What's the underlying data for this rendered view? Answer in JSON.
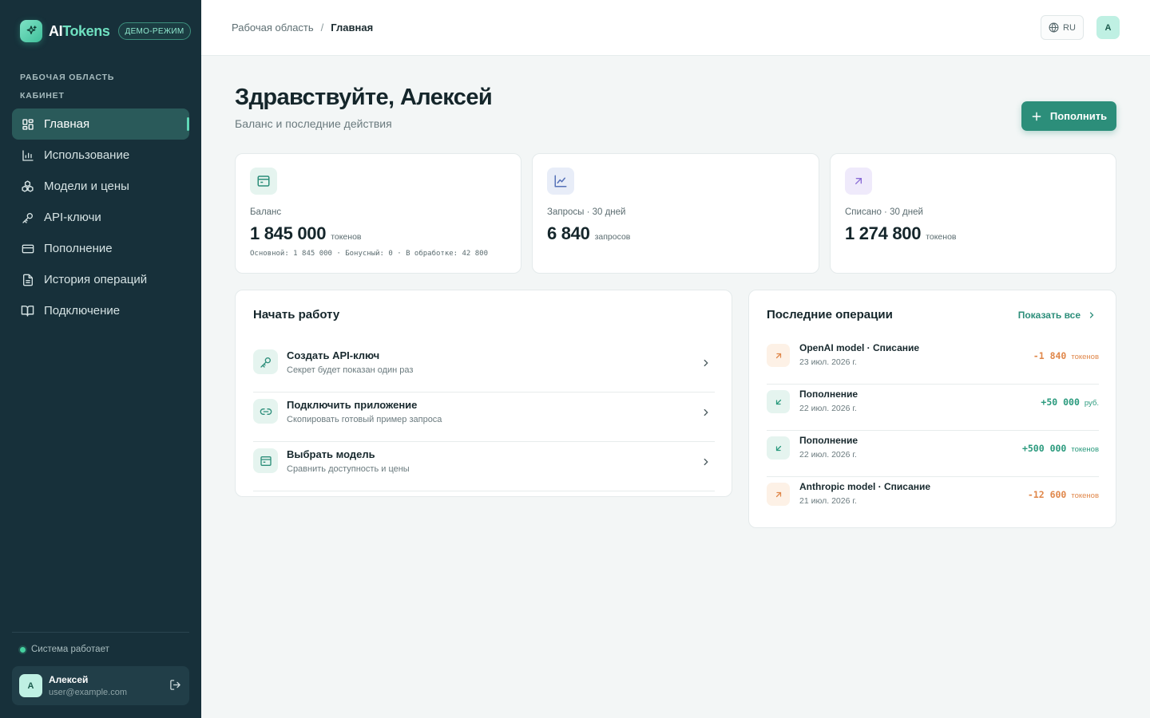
{
  "app": {
    "name_part1": "AI",
    "name_part2": "Tokens",
    "demo_badge": "ДЕМО-РЕЖИМ"
  },
  "sidebar": {
    "section_labels": [
      "РАБОЧАЯ ОБЛАСТЬ",
      "КАБИНЕТ"
    ],
    "items": [
      {
        "label": "Главная",
        "icon": "dashboard-icon",
        "active": true
      },
      {
        "label": "Использование",
        "icon": "bar-chart-icon"
      },
      {
        "label": "Модели и цены",
        "icon": "models-icon"
      },
      {
        "label": "API-ключи",
        "icon": "key-icon"
      },
      {
        "label": "Пополнение",
        "icon": "credit-card-icon"
      },
      {
        "label": "История операций",
        "icon": "document-icon"
      },
      {
        "label": "Подключение",
        "icon": "book-icon"
      }
    ],
    "system_status": "Система работает",
    "user": {
      "initial": "А",
      "name": "Алексей",
      "email": "user@example.com"
    }
  },
  "topbar": {
    "breadcrumb": {
      "root": "Рабочая область",
      "separator": "/",
      "current": "Главная"
    },
    "language": "RU",
    "avatar_initial": "А"
  },
  "main": {
    "greeting": "Здравствуйте, Алексей",
    "subtitle": "Баланс и последние действия",
    "topup_label": "Пополнить",
    "stats": [
      {
        "label": "Баланс",
        "value": "1 845 000",
        "unit": "токенов",
        "detail": "Основной: 1 845 000 · Бонусный: 0 · В обработке: 42 800",
        "icon": "wallet-icon"
      },
      {
        "label": "Запросы · 30 дней",
        "value": "6 840",
        "unit": "запросов",
        "icon": "line-chart-icon"
      },
      {
        "label": "Списано · 30 дней",
        "value": "1 274 800",
        "unit": "токенов",
        "icon": "arrow-up-right-icon"
      }
    ],
    "quick_start": {
      "title": "Начать работу",
      "items": [
        {
          "title": "Создать API-ключ",
          "desc": "Секрет будет показан один раз",
          "icon": "key-icon"
        },
        {
          "title": "Подключить приложение",
          "desc": "Скопировать готовый пример запроса",
          "icon": "link-icon"
        },
        {
          "title": "Выбрать модель",
          "desc": "Сравнить доступность и цены",
          "icon": "wallet-icon"
        }
      ]
    },
    "recent_ops": {
      "title": "Последние операции",
      "show_all": "Показать все",
      "items": [
        {
          "title": "OpenAI model · Списание",
          "date": "23 июл. 2026 г.",
          "amount": "-1 840",
          "unit": "токенов",
          "type": "debit"
        },
        {
          "title": "Пополнение",
          "date": "22 июл. 2026 г.",
          "amount": "+50 000",
          "unit": "руб.",
          "type": "credit"
        },
        {
          "title": "Пополнение",
          "date": "22 июл. 2026 г.",
          "amount": "+500 000",
          "unit": "токенов",
          "type": "credit"
        },
        {
          "title": "Anthropic model · Списание",
          "date": "21 июл. 2026 г.",
          "amount": "-12 600",
          "unit": "токенов",
          "type": "debit"
        }
      ]
    }
  },
  "colors": {
    "sidebar_bg": "#17303a",
    "accent": "#2c8e7a",
    "debit": "#e0874a",
    "credit": "#2a9a7d"
  }
}
